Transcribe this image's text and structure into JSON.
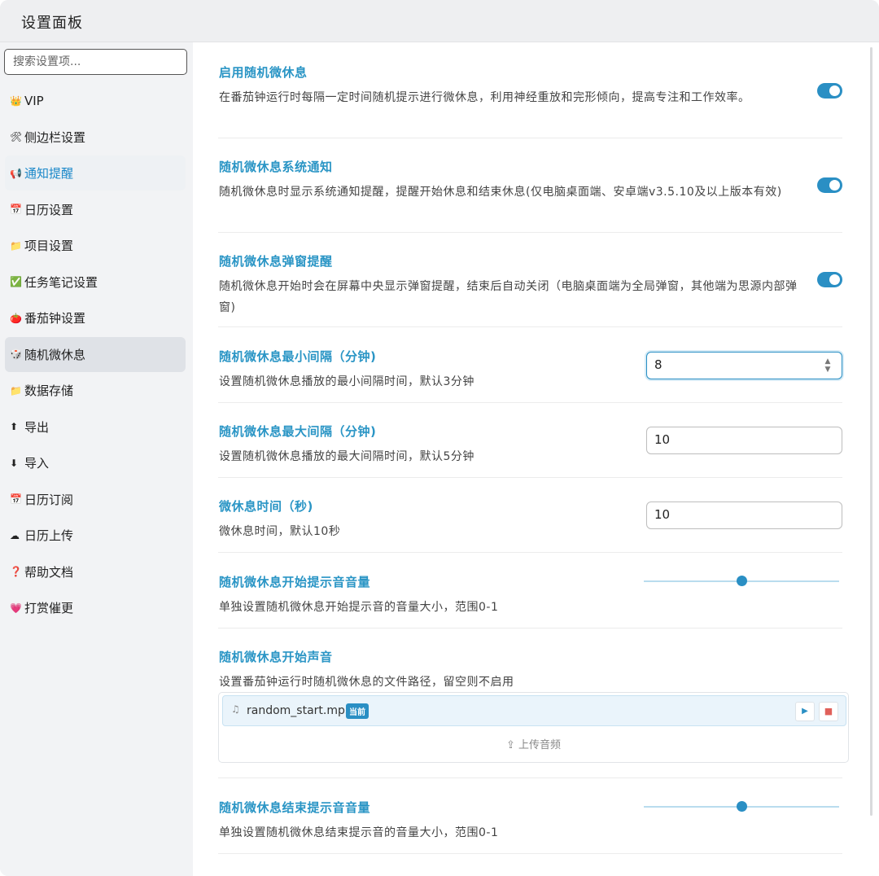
{
  "window": {
    "title": "设置面板"
  },
  "search": {
    "placeholder": "搜索设置项..."
  },
  "sidebar": {
    "items": [
      {
        "icon": "👑",
        "label": "VIP"
      },
      {
        "icon": "🛠",
        "label": "侧边栏设置"
      },
      {
        "icon": "📢",
        "label": "通知提醒"
      },
      {
        "icon": "📅",
        "label": "日历设置"
      },
      {
        "icon": "📁",
        "label": "项目设置"
      },
      {
        "icon": "✅",
        "label": "任务笔记设置"
      },
      {
        "icon": "🍅",
        "label": "番茄钟设置"
      },
      {
        "icon": "🎲",
        "label": "随机微休息"
      },
      {
        "icon": "📁",
        "label": "数据存储"
      },
      {
        "icon": "⬆",
        "label": "导出"
      },
      {
        "icon": "⬇",
        "label": "导入"
      },
      {
        "icon": "📅",
        "label": "日历订阅"
      },
      {
        "icon": "☁",
        "label": "日历上传"
      },
      {
        "icon": "❓",
        "label": "帮助文档"
      },
      {
        "icon": "💗",
        "label": "打赏催更"
      }
    ]
  },
  "settings": {
    "enable": {
      "title": "启用随机微休息",
      "desc": "在番茄钟运行时每隔一定时间随机提示进行微休息，利用神经重放和完形倾向，提高专注和工作效率。",
      "on": true
    },
    "notify": {
      "title": "随机微休息系统通知",
      "desc": "随机微休息时显示系统通知提醒，提醒开始休息和结束休息(仅电脑桌面端、安卓端v3.5.10及以上版本有效)",
      "on": true
    },
    "popup": {
      "title": "随机微休息弹窗提醒",
      "desc": "随机微休息开始时会在屏幕中央显示弹窗提醒，结束后自动关闭（电脑桌面端为全局弹窗，其他端为思源内部弹窗)",
      "on": true
    },
    "min_interval": {
      "title": "随机微休息最小间隔（分钟)",
      "desc": "设置随机微休息播放的最小间隔时间，默认3分钟",
      "value": "8"
    },
    "max_interval": {
      "title": "随机微休息最大间隔（分钟)",
      "desc": "设置随机微休息播放的最大间隔时间，默认5分钟",
      "value": "10"
    },
    "duration": {
      "title": "微休息时间（秒)",
      "desc": "微休息时间，默认10秒",
      "value": "10"
    },
    "start_volume": {
      "title": "随机微休息开始提示音音量",
      "desc": "单独设置随机微休息开始提示音的音量大小，范围0-1",
      "value": 0.5
    },
    "start_sound": {
      "title": "随机微休息开始声音",
      "desc": "设置番茄钟运行时随机微休息的文件路径，留空则不启用",
      "file_name": "random_start.mp3",
      "badge": "当前",
      "upload_label": "上传音频"
    },
    "end_volume": {
      "title": "随机微休息结束提示音音量",
      "desc": "单独设置随机微休息结束提示音的音量大小，范围0-1",
      "value": 0.5
    }
  },
  "colors": {
    "accent": "#2a8fc4",
    "title": "#2a95c5"
  }
}
